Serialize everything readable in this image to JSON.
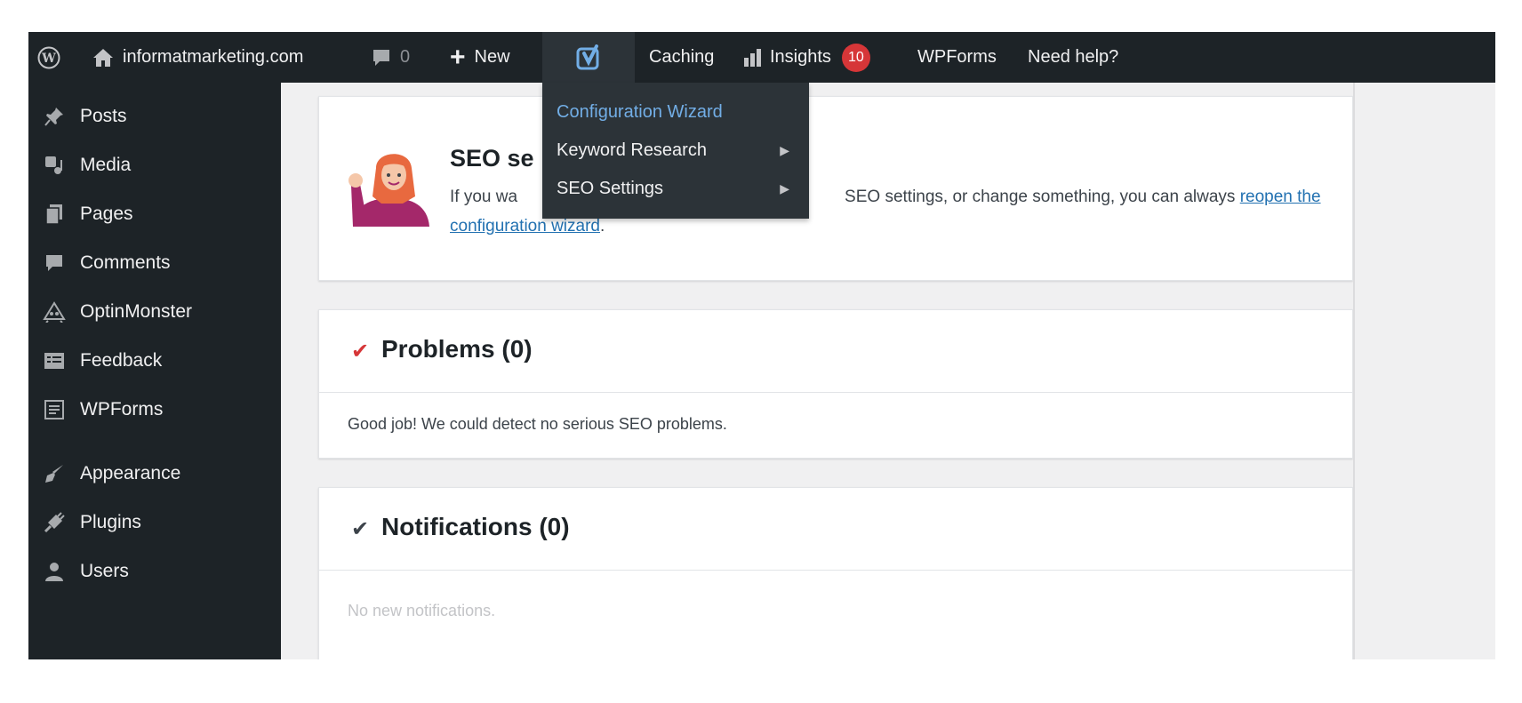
{
  "admin_bar": {
    "site": "informatmarketing.com",
    "comments_count": "0",
    "new_label": "New",
    "caching_label": "Caching",
    "insights_label": "Insights",
    "insights_badge": "10",
    "wpforms_label": "WPForms",
    "help_label": "Need help?"
  },
  "dropdown": {
    "items": [
      {
        "label": "Configuration Wizard",
        "active": true
      },
      {
        "label": "Keyword Research",
        "submenu": true
      },
      {
        "label": "SEO Settings",
        "submenu": true
      }
    ]
  },
  "sidebar": {
    "items": [
      {
        "label": "Posts",
        "icon": "pushpin-icon"
      },
      {
        "label": "Media",
        "icon": "media-icon"
      },
      {
        "label": "Pages",
        "icon": "pages-icon"
      },
      {
        "label": "Comments",
        "icon": "comment-icon"
      },
      {
        "label": "OptinMonster",
        "icon": "optinmonster-icon"
      },
      {
        "label": "Feedback",
        "icon": "feedback-icon"
      },
      {
        "label": "WPForms",
        "icon": "wpforms-icon"
      },
      {
        "label": "Appearance",
        "icon": "brush-icon"
      },
      {
        "label": "Plugins",
        "icon": "plug-icon"
      },
      {
        "label": "Users",
        "icon": "user-icon"
      }
    ]
  },
  "seo_card": {
    "title": "SEO se",
    "text_start": "If you wa",
    "text_mid": "SEO settings, or change something, you can always ",
    "link1": "reopen the",
    "link2": "configuration wizard",
    "text_end": "."
  },
  "problems": {
    "title": "Problems (0)",
    "body": "Good job! We could detect no serious SEO problems."
  },
  "notifications": {
    "title": "Notifications (0)",
    "body": "No new notifications."
  },
  "colors": {
    "admin_bar": "#1d2327",
    "menu_highlight": "#72aee6",
    "badge": "#d63638",
    "problems_check": "#d63638",
    "notifications_check": "#3c434a",
    "link": "#2271b1"
  }
}
